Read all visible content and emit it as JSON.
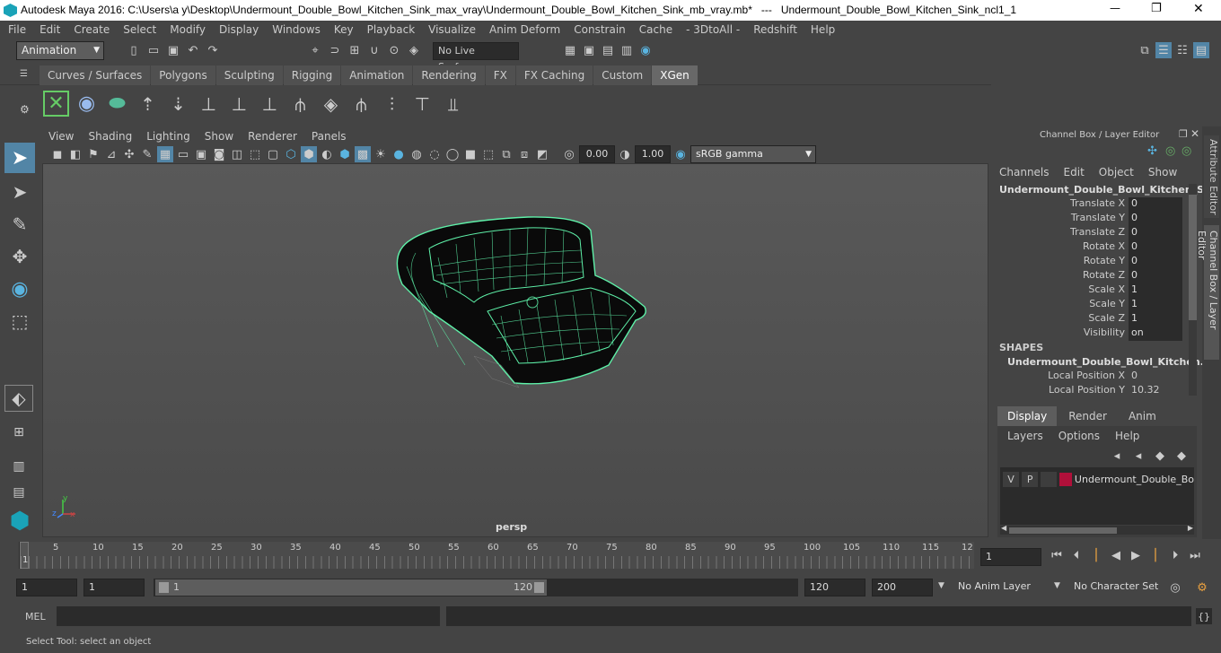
{
  "window": {
    "title": "Autodesk Maya 2016: C:\\Users\\a y\\Desktop\\Undermount_Double_Bowl_Kitchen_Sink_max_vray\\Undermount_Double_Bowl_Kitchen_Sink_mb_vray.mb*   ---   Undermount_Double_Bowl_Kitchen_Sink_ncl1_1",
    "min": "—",
    "max": "❐",
    "close": "✕"
  },
  "menu": [
    "File",
    "Edit",
    "Create",
    "Select",
    "Modify",
    "Display",
    "Windows",
    "Key",
    "Playback",
    "Visualize",
    "Anim Deform",
    "Constrain",
    "Cache",
    "- 3DtoAll -",
    "Redshift",
    "Help"
  ],
  "status": {
    "mode": "Animation",
    "live_surface": "No Live Surface"
  },
  "shelf_tabs": [
    "Curves / Surfaces",
    "Polygons",
    "Sculpting",
    "Rigging",
    "Animation",
    "Rendering",
    "FX",
    "FX Caching",
    "Custom",
    "XGen"
  ],
  "shelf_active": "XGen",
  "viewport": {
    "menu": [
      "View",
      "Shading",
      "Lighting",
      "Show",
      "Renderer",
      "Panels"
    ],
    "exposure": "0.00",
    "gamma": "1.00",
    "colorspace": "sRGB gamma",
    "camera": "persp"
  },
  "channel_box": {
    "title": "Channel Box / Layer Editor",
    "menu": [
      "Channels",
      "Edit",
      "Object",
      "Show"
    ],
    "object": "Undermount_Double_Bowl_Kitchen_S...",
    "attrs": [
      {
        "label": "Translate X",
        "value": "0"
      },
      {
        "label": "Translate Y",
        "value": "0"
      },
      {
        "label": "Translate Z",
        "value": "0"
      },
      {
        "label": "Rotate X",
        "value": "0"
      },
      {
        "label": "Rotate Y",
        "value": "0"
      },
      {
        "label": "Rotate Z",
        "value": "0"
      },
      {
        "label": "Scale X",
        "value": "1"
      },
      {
        "label": "Scale Y",
        "value": "1"
      },
      {
        "label": "Scale Z",
        "value": "1"
      },
      {
        "label": "Visibility",
        "value": "on"
      }
    ],
    "shapes_header": "SHAPES",
    "shape_name": "Undermount_Double_Bowl_Kitchen...",
    "shape_attrs": [
      {
        "label": "Local Position X",
        "value": "0"
      },
      {
        "label": "Local Position Y",
        "value": "10.32"
      }
    ]
  },
  "layer_editor": {
    "tabs": [
      "Display",
      "Render",
      "Anim"
    ],
    "active": "Display",
    "menu": [
      "Layers",
      "Options",
      "Help"
    ],
    "layer": {
      "v": "V",
      "p": "P",
      "name": "Undermount_Double_Bo"
    }
  },
  "side_tabs": {
    "attr": "Attribute Editor",
    "channel": "Channel Box / Layer Editor"
  },
  "timeline": {
    "ticks": [
      "5",
      "10",
      "15",
      "20",
      "25",
      "30",
      "35",
      "40",
      "45",
      "50",
      "55",
      "60",
      "65",
      "70",
      "75",
      "80",
      "85",
      "90",
      "95",
      "100",
      "105",
      "110",
      "115",
      "12"
    ],
    "start_label": "1",
    "current": "1"
  },
  "range": {
    "start": "1",
    "anim_start": "1",
    "slider_start": "1",
    "slider_end": "120",
    "end": "120",
    "anim_end": "200",
    "anim_layer": "No Anim Layer",
    "char_set": "No Character Set"
  },
  "command": {
    "label": "MEL"
  },
  "help_line": "Select Tool: select an object",
  "axis": {
    "x": "x",
    "y": "y",
    "z": "z"
  },
  "colors": {
    "wire": "#5ef0a8",
    "layer": "#b0103a",
    "accent": "#5285a6"
  }
}
